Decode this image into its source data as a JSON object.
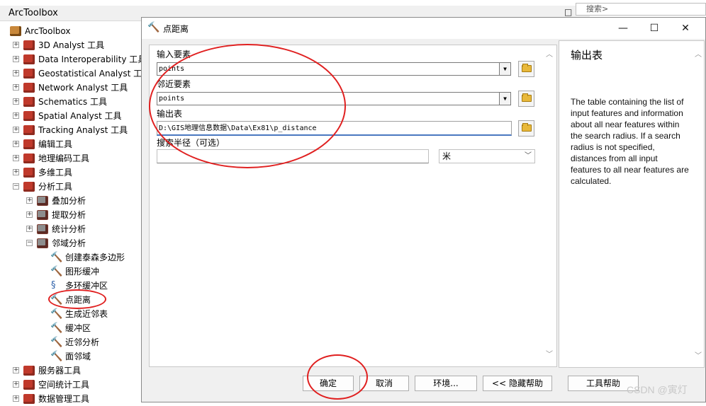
{
  "toolbox": {
    "title": "ArcToolbox",
    "ctrl_restore": "□",
    "ctrl_close": "×",
    "search_fragment": "搜索>",
    "root_label": "ArcToolbox",
    "items": [
      {
        "label": "3D Analyst 工具",
        "expander": "+",
        "icon": "toolbox-icon"
      },
      {
        "label": "Data Interoperability 工具",
        "expander": "+",
        "icon": "toolbox-icon"
      },
      {
        "label": "Geostatistical Analyst 工具",
        "expander": "+",
        "icon": "toolbox-icon"
      },
      {
        "label": "Network Analyst 工具",
        "expander": "+",
        "icon": "toolbox-icon"
      },
      {
        "label": "Schematics 工具",
        "expander": "+",
        "icon": "toolbox-icon"
      },
      {
        "label": "Spatial Analyst 工具",
        "expander": "+",
        "icon": "toolbox-icon"
      },
      {
        "label": "Tracking Analyst 工具",
        "expander": "+",
        "icon": "toolbox-icon"
      },
      {
        "label": "编辑工具",
        "expander": "+",
        "icon": "toolbox-icon"
      },
      {
        "label": "地理编码工具",
        "expander": "+",
        "icon": "toolbox-icon"
      },
      {
        "label": "多维工具",
        "expander": "+",
        "icon": "toolbox-icon"
      },
      {
        "label": "分析工具",
        "expander": "−",
        "icon": "toolbox-icon"
      },
      {
        "label": "叠加分析",
        "expander": "+",
        "icon": "toolset-icon"
      },
      {
        "label": "提取分析",
        "expander": "+",
        "icon": "toolset-icon"
      },
      {
        "label": "统计分析",
        "expander": "+",
        "icon": "toolset-icon"
      },
      {
        "label": "邻域分析",
        "expander": "−",
        "icon": "toolset-icon"
      },
      {
        "label": "创建泰森多边形",
        "icon": "hammer-icon"
      },
      {
        "label": "图形缓冲",
        "icon": "hammer-icon"
      },
      {
        "label": "多环缓冲区",
        "icon": "script-icon"
      },
      {
        "label": "点距离",
        "icon": "hammer-icon"
      },
      {
        "label": "生成近邻表",
        "icon": "hammer-icon"
      },
      {
        "label": "缓冲区",
        "icon": "hammer-icon"
      },
      {
        "label": "近邻分析",
        "icon": "hammer-icon"
      },
      {
        "label": "面邻域",
        "icon": "hammer-icon"
      },
      {
        "label": "服务器工具",
        "expander": "+",
        "icon": "toolbox-icon"
      },
      {
        "label": "空间统计工具",
        "expander": "+",
        "icon": "toolbox-icon"
      },
      {
        "label": "数据管理工具",
        "expander": "+",
        "icon": "toolbox-icon"
      }
    ]
  },
  "dialog": {
    "title": "点距离",
    "title_icon": "🔨",
    "min_glyph": "—",
    "max_glyph": "☐",
    "close_glyph": "✕",
    "fields": {
      "input_label": "输入要素",
      "input_value": "points",
      "near_label": "邻近要素",
      "near_value": "points",
      "output_label": "输出表",
      "output_value": "D:\\GIS地理信息数据\\Data\\Ex81\\p_distance",
      "radius_label": "搜索半径（可选）",
      "radius_value": "",
      "unit_value": "米"
    },
    "help": {
      "title": "输出表",
      "body": "The table containing the list of input features and information about all near features within the search radius. If a search radius is not specified, distances from all input features to all near features are calculated."
    },
    "buttons": {
      "ok": "确定",
      "cancel": "取消",
      "env": "环境...",
      "hide_help": "<< 隐藏帮助",
      "tool_help": "工具帮助"
    }
  },
  "watermark": "CSDN @寅灯",
  "colors": {
    "annotation_ring": "#e02020",
    "toolbox_red": "#c0392b",
    "focus_blue": "#4a78c0"
  }
}
